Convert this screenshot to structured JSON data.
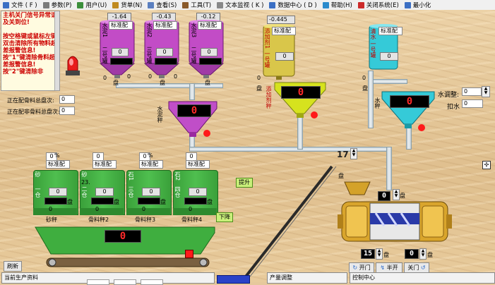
{
  "menu": [
    {
      "label": "文件 ( F )",
      "icon": "file-icon",
      "color": "#3b6fc4"
    },
    {
      "label": "参数(P)",
      "icon": "gear-icon",
      "color": "#7a7a7a"
    },
    {
      "label": "用户(U)",
      "icon": "user-icon",
      "color": "#3b8f3b"
    },
    {
      "label": "货单(N)",
      "icon": "order-icon",
      "color": "#c08a20"
    },
    {
      "label": "查看(S)",
      "icon": "view-icon",
      "color": "#5a7fc0"
    },
    {
      "label": "工具(T)",
      "icon": "tool-icon",
      "color": "#8a5a2a"
    },
    {
      "label": "文本监视 ( K )",
      "icon": "monitor-icon",
      "color": "#888888"
    },
    {
      "label": "数据中心 ( D )",
      "icon": "data-icon",
      "color": "#3b6fc4"
    },
    {
      "label": "帮助(H)",
      "icon": "help-icon",
      "color": "#2a8acc"
    },
    {
      "label": "关闭系统(E)",
      "icon": "close-system-icon",
      "color": "#cc2a2a"
    },
    {
      "label": "最小化",
      "icon": "minimize-icon",
      "color": "#3b6fc4"
    }
  ],
  "notice": {
    "text": "主机关门信号异常请及关到位!\n\n按空格键或鼠标左键双击清除所有物料超差报警信息!按\"1\"键清除骨料超差报警信息!按\"2\"键清除非"
  },
  "pending": {
    "mix_label": "正在配骨料总盘次:",
    "mix_value": "0",
    "nonmix_label": "正在配非骨料总盘次:",
    "nonmix_value": "0"
  },
  "cement_silos": [
    {
      "label": "水泥1",
      "sub": "二号罐",
      "display": "-1.64",
      "value": "0",
      "tag": "标准配"
    },
    {
      "label": "水泥2",
      "sub": "三号罐",
      "display": "-0.43",
      "value": "0",
      "tag": "标准配"
    },
    {
      "label": "水泥3",
      "sub": "二号罐",
      "display": "-0.12",
      "value": "0",
      "tag": "标准配"
    }
  ],
  "cement_bottom_marks": [
    "0",
    "盘",
    "0",
    "0",
    "盘",
    "0",
    "盘"
  ],
  "cement_scale": {
    "label": "水泥秤",
    "value": "0"
  },
  "additive": {
    "silo_label": "添加剂1",
    "silo_sub": "一号罐",
    "display": "-0.445",
    "value": "0",
    "tag": "标准配",
    "scale_label": "添加剂秤",
    "scale_value": "0",
    "mark": "盘",
    "zero": "0"
  },
  "water": {
    "silo_label": "清水",
    "silo_sub": "一号罐",
    "value": "0",
    "tag": "标准配",
    "scale_label": "水秤",
    "scale_value": "0",
    "mark": "盘",
    "zero": "0",
    "adjust_label": "水调整:",
    "adjust_value": "0",
    "deduct_label": "扣水",
    "deduct_value": "0"
  },
  "aggregate_bins": [
    {
      "name": "砂",
      "sub": "一仓",
      "pct": "0",
      "pct_unit": "%",
      "tag": "标准配",
      "value": "0",
      "num": "0",
      "mark": "盘"
    },
    {
      "name": "砂",
      "sub": "二仓",
      "num2": "23.",
      "pct": "0",
      "tag": "标准配",
      "value": "0",
      "num": "0",
      "mark": "盘"
    },
    {
      "name": "石1",
      "sub": "三仓",
      "pct": "0",
      "pct_unit": "%",
      "tag": "标准配",
      "value": "0",
      "num": "0",
      "mark": "盘"
    },
    {
      "name": "石2",
      "sub": "四仓",
      "pct": "0",
      "tag": "标准配",
      "value": "0",
      "num": "0",
      "mark": "盘"
    }
  ],
  "scale_labels": [
    "砂秤",
    "骨料秤2",
    "骨料秤3",
    "骨料秤4"
  ],
  "belt": {
    "value": "0"
  },
  "buttons": {
    "lift": "提升",
    "down": "下降",
    "refresh": "刷新"
  },
  "mixer": {
    "top_value": "0",
    "top_mark": "盘",
    "time": "17",
    "left_value": "15",
    "right_value": "0",
    "mark": "盘",
    "open": "开门",
    "halfopen": "半开",
    "close": "关门"
  },
  "bottom": {
    "production_label": "当前生产资料",
    "yield_label": "产量调整",
    "control_label": "控制中心"
  }
}
